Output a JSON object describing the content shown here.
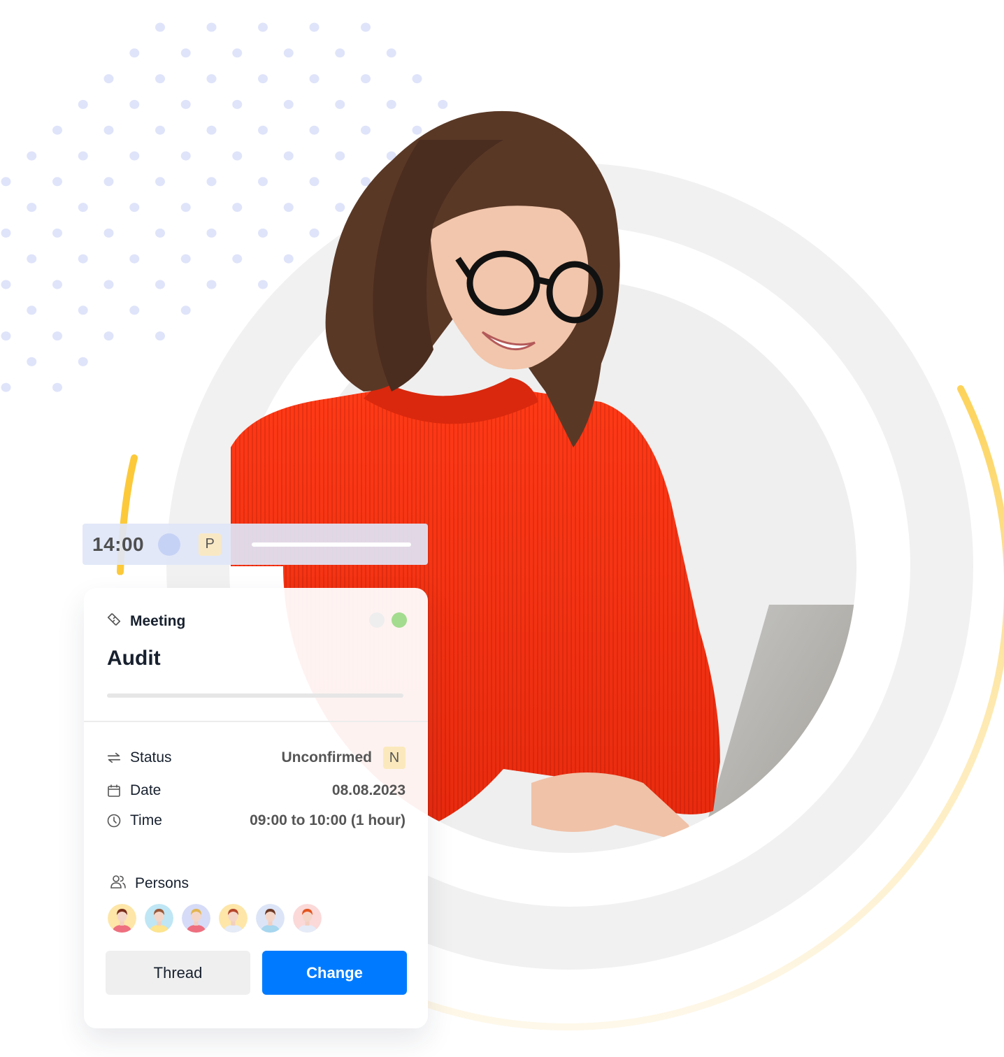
{
  "time_bar": {
    "time": "14:00",
    "badge": "P"
  },
  "card": {
    "type_label": "Meeting",
    "type_icon": "handshake-icon",
    "title": "Audit",
    "indicator_colors": [
      "#eeeeee",
      "#a3dc8f"
    ],
    "details": [
      {
        "icon": "arrows-exchange-icon",
        "label": "Status",
        "value": "Unconfirmed",
        "badge": "N"
      },
      {
        "icon": "calendar-icon",
        "label": "Date",
        "value": "08.08.2023"
      },
      {
        "icon": "clock-icon",
        "label": "Time",
        "value": "09:00 to 10:00 (1 hour)"
      }
    ],
    "persons_label": "Persons",
    "persons_icon": "users-icon",
    "persons": [
      {
        "bg": "#fde6a8",
        "hair": "#7a2e1c",
        "shirt": "#ee6f7f"
      },
      {
        "bg": "#bfe6f4",
        "hair": "#9a5a3a",
        "shirt": "#fde48f"
      },
      {
        "bg": "#d6dcf7",
        "hair": "#e2b550",
        "shirt": "#ee6f7f"
      },
      {
        "bg": "#fde6a8",
        "hair": "#b5462c",
        "shirt": "#e5ebf7"
      },
      {
        "bg": "#dce5f7",
        "hair": "#6e3a26",
        "shirt": "#a7d6ef"
      },
      {
        "bg": "#fbd9d9",
        "hair": "#e3551f",
        "shirt": "#e5ebf7"
      }
    ],
    "buttons": {
      "thread": "Thread",
      "change": "Change"
    }
  },
  "colors": {
    "accent_blue": "#007bff",
    "accent_yellow": "#fcc93a",
    "ring_gray": "#f1f1f1",
    "dot_blue": "#dfe4fa"
  }
}
